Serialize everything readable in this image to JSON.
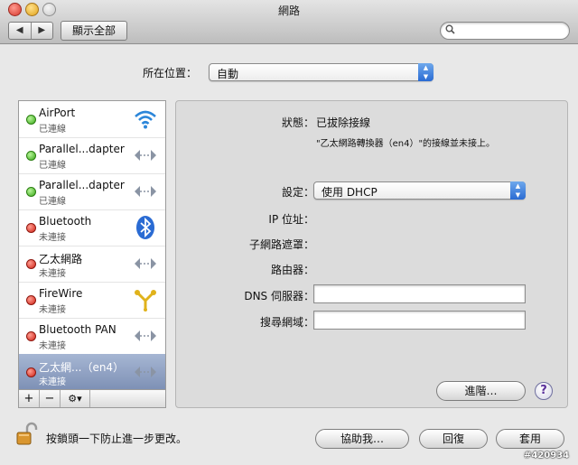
{
  "window": {
    "title": "網路"
  },
  "toolbar": {
    "back_glyph": "◀",
    "forward_glyph": "▶",
    "show_all": "顯示全部",
    "search_placeholder": "",
    "search_icon": "magnifier-icon"
  },
  "location": {
    "label": "所在位置：",
    "value": "自動"
  },
  "services": [
    {
      "name": "AirPort",
      "status": "已連線",
      "connected": true,
      "icon": "airport-wifi-icon"
    },
    {
      "name": "Parallel...dapter",
      "status": "已連線",
      "connected": true,
      "icon": "ethernet-arrows-icon"
    },
    {
      "name": "Parallel...dapter",
      "status": "已連線",
      "connected": true,
      "icon": "ethernet-arrows-icon"
    },
    {
      "name": "Bluetooth",
      "status": "未連接",
      "connected": false,
      "icon": "bluetooth-icon"
    },
    {
      "name": "乙太網路",
      "status": "未連接",
      "connected": false,
      "icon": "ethernet-arrows-icon"
    },
    {
      "name": "FireWire",
      "status": "未連接",
      "connected": false,
      "icon": "firewire-icon"
    },
    {
      "name": "Bluetooth PAN",
      "status": "未連接",
      "connected": false,
      "icon": "ethernet-arrows-icon"
    },
    {
      "name": "乙太網...（en4）",
      "status": "未連接",
      "connected": false,
      "icon": "ethernet-arrows-icon",
      "selected": true
    }
  ],
  "sidebar_buttons": {
    "add": "+",
    "remove": "−",
    "action": "⚙▾"
  },
  "detail": {
    "status_label": "狀態：",
    "status_value": "已拔除接線",
    "status_desc": "\"乙太網路轉換器（en4）\"的接線並未接上。",
    "config_label": "設定：",
    "config_value": "使用 DHCP",
    "ip_label": "IP 位址：",
    "subnet_label": "子網路遮罩：",
    "router_label": "路由器：",
    "dns_label": "DNS 伺服器：",
    "search_domain_label": "搜尋網域：",
    "dns_value": "",
    "search_domain_value": "",
    "advanced": "進階…",
    "help": "?"
  },
  "footer": {
    "lock_text": "按鎖頭一下防止進一步更改。",
    "assist": "協助我…",
    "revert": "回復",
    "apply": "套用",
    "watermark": "#420934"
  },
  "colors": {
    "selection": "#8a9cc0",
    "accent_blue": "#2a6bd3",
    "connected": "#39a818",
    "disconnected": "#cf2216"
  }
}
